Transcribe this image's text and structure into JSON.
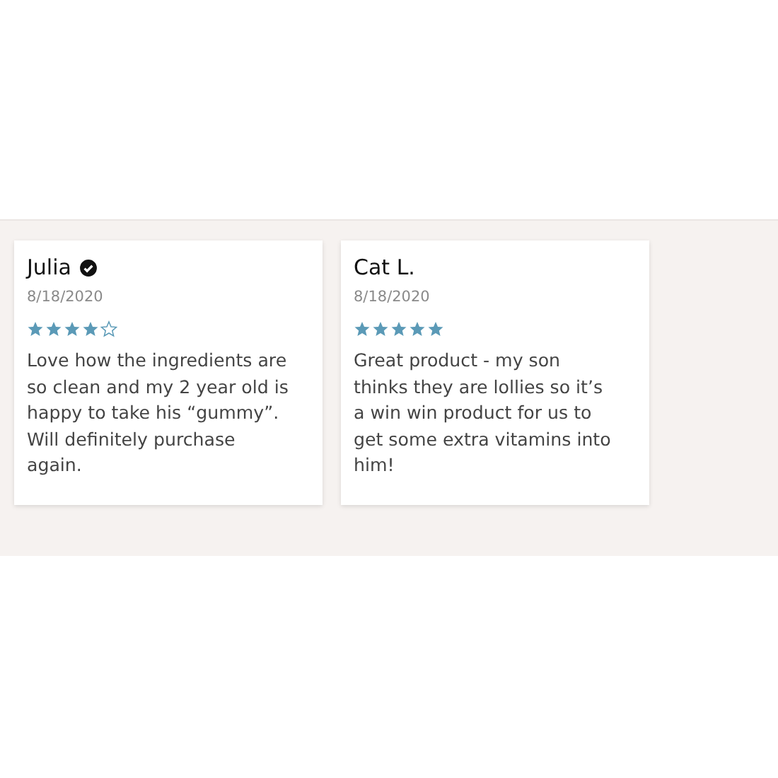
{
  "reviews": [
    {
      "name": "Julia",
      "verified": true,
      "date": "8/18/2020",
      "stars": 4,
      "text": "Love how the ingredients are so clean and my 2 year old is happy to take his “gummy”. Will definitely purchase again."
    },
    {
      "name": "Cat L.",
      "verified": false,
      "date": "8/18/2020",
      "stars": 5,
      "text": "Great product - my son thinks they are lollies so it’s a win win product for us to get some extra vitamins into him!"
    }
  ]
}
